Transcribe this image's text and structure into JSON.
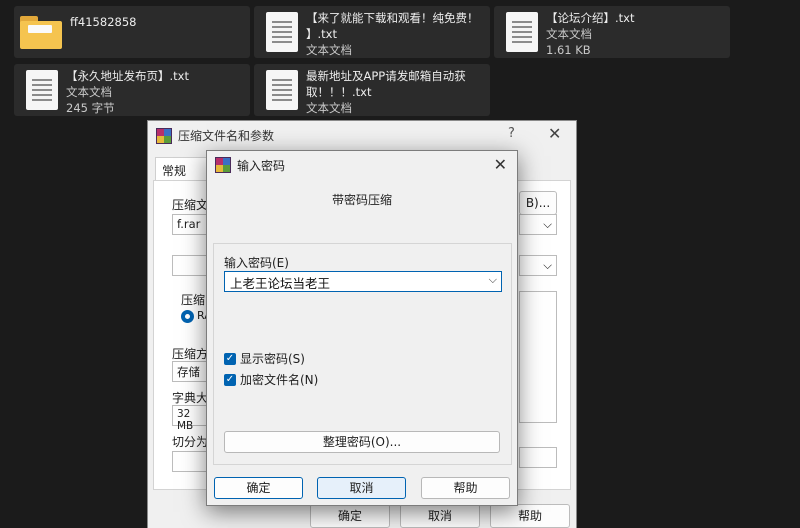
{
  "explorer": {
    "items": [
      {
        "name": "ff41582858",
        "type": "",
        "size": "",
        "icon": "folder-icon"
      },
      {
        "name_line1": "【来了就能下载和观看！纯免费！",
        "name_line2": "】.txt",
        "type": "文本文档",
        "icon": "text-document-icon"
      },
      {
        "name": "【论坛介绍】.txt",
        "type": "文本文档",
        "size": "1.61 KB",
        "icon": "text-document-icon"
      },
      {
        "name": "【永久地址发布页】.txt",
        "type": "文本文档",
        "size": "245 字节",
        "icon": "text-document-icon"
      },
      {
        "name_line1": "最新地址及APP请发邮箱自动获",
        "name_line2": "取！！！.txt",
        "type": "文本文档",
        "icon": "text-document-icon"
      }
    ]
  },
  "back_dialog": {
    "title": "压缩文件名和参数",
    "help": "?",
    "close": "✕",
    "tab_general": "常规",
    "archive_name_label": "压缩文",
    "archive_name_value": "f.rar",
    "browse_suffix": "B)...",
    "format_label": "压缩",
    "format_radio": "RA",
    "method_label": "压缩方",
    "method_value": "存储",
    "dict_label": "字典大",
    "dict_value": "32 MB",
    "split_label": "切分为",
    "ok": "确定",
    "cancel": "取消",
    "help_btn": "帮助"
  },
  "password_dialog": {
    "title": "输入密码",
    "close": "✕",
    "heading": "带密码压缩",
    "enter_label": "输入密码(E)",
    "password_value": "上老王论坛当老王",
    "show_password": {
      "label": "显示密码(S)",
      "checked": true
    },
    "encrypt_names": {
      "label": "加密文件名(N)",
      "checked": true
    },
    "organize": "整理密码(O)...",
    "ok": "确定",
    "cancel": "取消",
    "help": "帮助"
  },
  "colors": {
    "accent": "#0063b1",
    "folder": "#f5c44f",
    "background": "#1b1b1b"
  }
}
